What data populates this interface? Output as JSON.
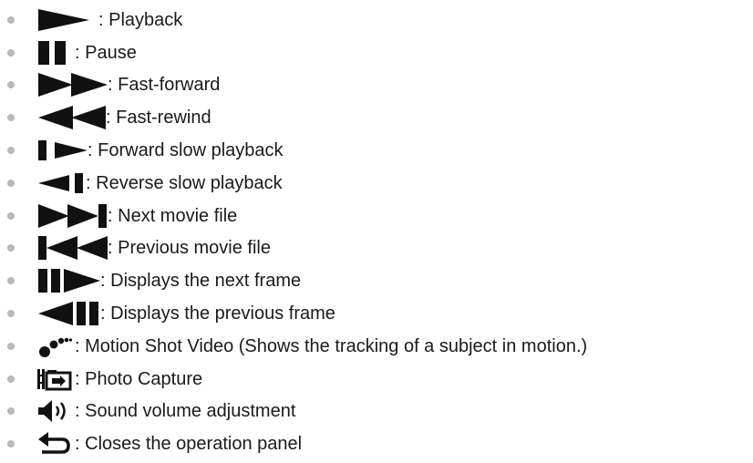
{
  "separator": ":",
  "items": [
    {
      "icon": "play-icon",
      "label": "Playback"
    },
    {
      "icon": "pause-icon",
      "label": "Pause"
    },
    {
      "icon": "fast-forward-icon",
      "label": "Fast-forward"
    },
    {
      "icon": "fast-rewind-icon",
      "label": "Fast-rewind"
    },
    {
      "icon": "forward-slow-playback-icon",
      "label": "Forward slow playback"
    },
    {
      "icon": "reverse-slow-playback-icon",
      "label": "Reverse slow playback"
    },
    {
      "icon": "next-movie-file-icon",
      "label": "Next movie file"
    },
    {
      "icon": "previous-movie-file-icon",
      "label": "Previous movie file"
    },
    {
      "icon": "next-frame-icon",
      "label": "Displays the next frame"
    },
    {
      "icon": "previous-frame-icon",
      "label": "Displays the previous frame"
    },
    {
      "icon": "motion-shot-video-icon",
      "label": "Motion Shot Video (Shows the tracking of a subject in motion.)"
    },
    {
      "icon": "photo-capture-icon",
      "label": "Photo Capture"
    },
    {
      "icon": "sound-volume-icon",
      "label": "Sound volume adjustment"
    },
    {
      "icon": "return-icon",
      "label": "Closes the operation panel"
    }
  ]
}
